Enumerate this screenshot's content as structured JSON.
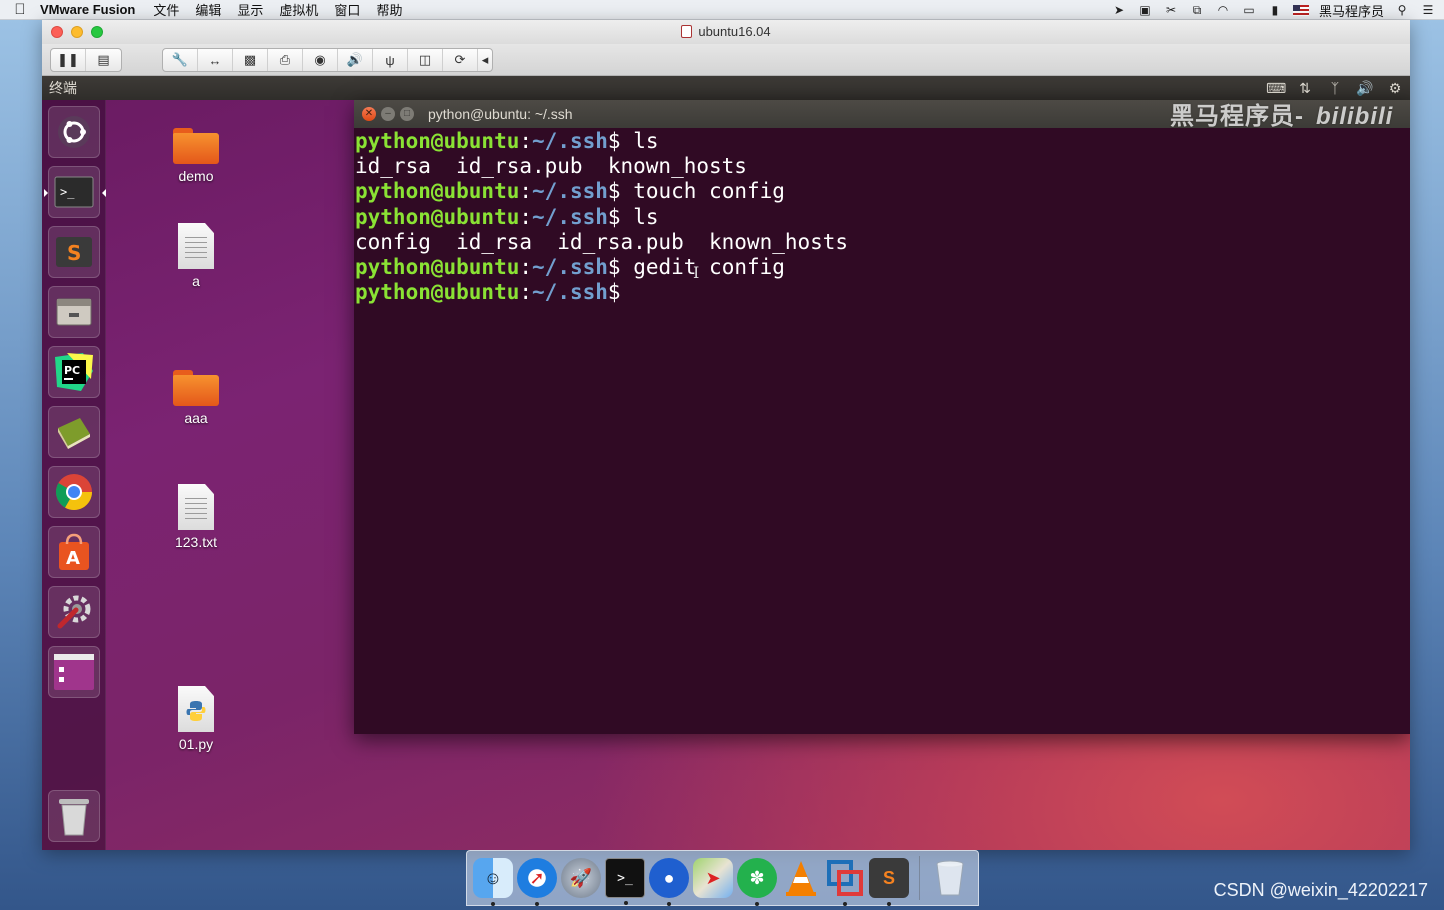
{
  "mac_menubar": {
    "app_name": "VMware Fusion",
    "menus": [
      "文件",
      "编辑",
      "显示",
      "虚拟机",
      "窗口",
      "帮助"
    ],
    "status_user": "黑马程序员"
  },
  "vm_window": {
    "title": "ubuntu16.04"
  },
  "guest": {
    "topbar_title": "终端",
    "desktop_icons": [
      {
        "label": "demo",
        "type": "folder"
      },
      {
        "label": "a",
        "type": "document"
      },
      {
        "label": "aaa",
        "type": "folder"
      },
      {
        "label": "123.txt",
        "type": "document"
      },
      {
        "label": "01.py",
        "type": "python"
      }
    ],
    "launcher_items": [
      "ubuntu-dash-icon",
      "terminal-icon",
      "sublime-icon",
      "files-icon",
      "pycharm-icon",
      "book-icon",
      "chrome-icon",
      "software-center-icon",
      "settings-icon",
      "workspace-icon",
      "trash-icon"
    ]
  },
  "terminal": {
    "title": "python@ubuntu: ~/.ssh",
    "prompt_user": "python@ubuntu",
    "prompt_colon": ":",
    "prompt_path": "~/.ssh",
    "prompt_symbol": "$",
    "lines": [
      {
        "kind": "prompt",
        "cmd": " ls"
      },
      {
        "kind": "output",
        "text": "id_rsa  id_rsa.pub  known_hosts"
      },
      {
        "kind": "prompt",
        "cmd": " touch config"
      },
      {
        "kind": "prompt",
        "cmd": " ls"
      },
      {
        "kind": "output",
        "text": "config  id_rsa  id_rsa.pub  known_hosts"
      },
      {
        "kind": "prompt",
        "cmd": " gedit config"
      },
      {
        "kind": "prompt",
        "cmd": ""
      }
    ]
  },
  "watermark": {
    "text": "黑马程序员-",
    "bili": "bilibili"
  },
  "dock": {
    "items": [
      "finder-icon",
      "safari-icon",
      "launchpad-icon",
      "terminal-icon",
      "screen-recorder-icon",
      "maps-icon",
      "mindnode-icon",
      "vlc-icon",
      "vmware-icon",
      "sublime-icon"
    ]
  },
  "csdn_watermark": "CSDN @weixin_42202217",
  "colors": {
    "terminal_bg": "#300a24",
    "prompt_user": "#8ae234",
    "prompt_path": "#729fcf",
    "ubuntu_topbar": "#3c3b37"
  }
}
